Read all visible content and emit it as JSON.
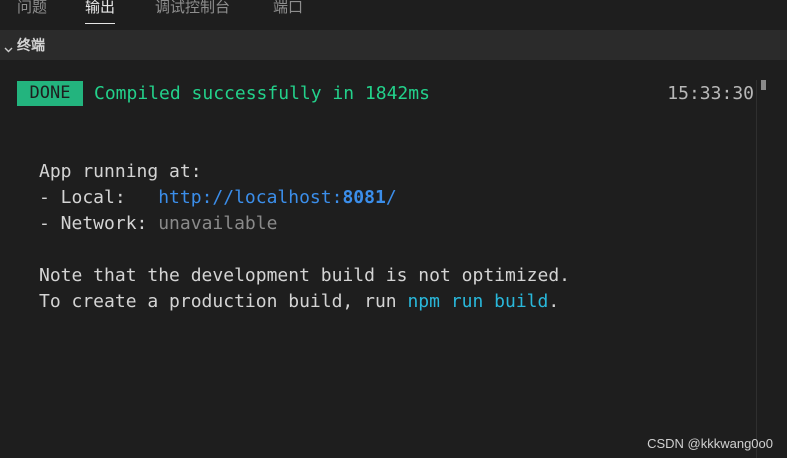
{
  "tabs": [
    {
      "label": "问题",
      "active": false
    },
    {
      "label": "输出",
      "active": true
    },
    {
      "label": "调试控制台",
      "active": false
    },
    {
      "label": "端口",
      "active": false
    }
  ],
  "section": {
    "title": "终端",
    "expanded": true,
    "icon": "chevron-down-icon"
  },
  "terminal": {
    "done_badge": "DONE",
    "compiled_message": "Compiled successfully in 1842ms",
    "timestamp": "15:33:30",
    "app_running": "App running at:",
    "local_prefix": "- Local:   ",
    "local_url_pre": "http://localhost:",
    "local_url_port": "8081",
    "local_url_post": "/",
    "network_prefix": "- Network: ",
    "network_value": "unavailable",
    "note_line": "Note that the development build is not optimized.",
    "build_prefix": "To create a production build, run ",
    "build_command": "npm run build",
    "build_suffix": "."
  },
  "watermark": "CSDN @kkkwang0o0",
  "colors": {
    "background": "#1e1e1e",
    "done_badge": "#23b47e",
    "success_text": "#23d18b",
    "link": "#3b8eea",
    "command": "#29b8db",
    "muted": "#8a8a8a"
  }
}
